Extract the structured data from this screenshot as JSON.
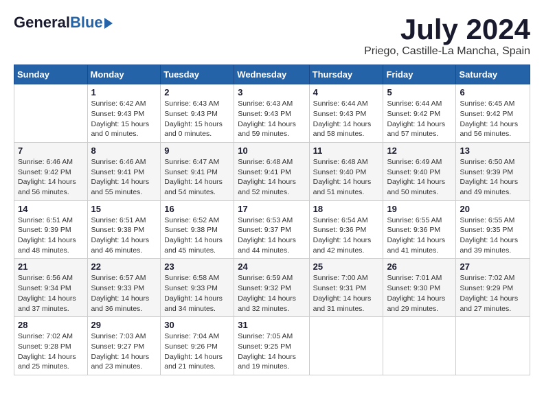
{
  "logo": {
    "general": "General",
    "blue": "Blue"
  },
  "title": {
    "month_year": "July 2024",
    "location": "Priego, Castille-La Mancha, Spain"
  },
  "days_of_week": [
    "Sunday",
    "Monday",
    "Tuesday",
    "Wednesday",
    "Thursday",
    "Friday",
    "Saturday"
  ],
  "weeks": [
    [
      {
        "day": "",
        "info": ""
      },
      {
        "day": "1",
        "info": "Sunrise: 6:42 AM\nSunset: 9:43 PM\nDaylight: 15 hours\nand 0 minutes."
      },
      {
        "day": "2",
        "info": "Sunrise: 6:43 AM\nSunset: 9:43 PM\nDaylight: 15 hours\nand 0 minutes."
      },
      {
        "day": "3",
        "info": "Sunrise: 6:43 AM\nSunset: 9:43 PM\nDaylight: 14 hours\nand 59 minutes."
      },
      {
        "day": "4",
        "info": "Sunrise: 6:44 AM\nSunset: 9:43 PM\nDaylight: 14 hours\nand 58 minutes."
      },
      {
        "day": "5",
        "info": "Sunrise: 6:44 AM\nSunset: 9:42 PM\nDaylight: 14 hours\nand 57 minutes."
      },
      {
        "day": "6",
        "info": "Sunrise: 6:45 AM\nSunset: 9:42 PM\nDaylight: 14 hours\nand 56 minutes."
      }
    ],
    [
      {
        "day": "7",
        "info": "Sunrise: 6:46 AM\nSunset: 9:42 PM\nDaylight: 14 hours\nand 56 minutes."
      },
      {
        "day": "8",
        "info": "Sunrise: 6:46 AM\nSunset: 9:41 PM\nDaylight: 14 hours\nand 55 minutes."
      },
      {
        "day": "9",
        "info": "Sunrise: 6:47 AM\nSunset: 9:41 PM\nDaylight: 14 hours\nand 54 minutes."
      },
      {
        "day": "10",
        "info": "Sunrise: 6:48 AM\nSunset: 9:41 PM\nDaylight: 14 hours\nand 52 minutes."
      },
      {
        "day": "11",
        "info": "Sunrise: 6:48 AM\nSunset: 9:40 PM\nDaylight: 14 hours\nand 51 minutes."
      },
      {
        "day": "12",
        "info": "Sunrise: 6:49 AM\nSunset: 9:40 PM\nDaylight: 14 hours\nand 50 minutes."
      },
      {
        "day": "13",
        "info": "Sunrise: 6:50 AM\nSunset: 9:39 PM\nDaylight: 14 hours\nand 49 minutes."
      }
    ],
    [
      {
        "day": "14",
        "info": "Sunrise: 6:51 AM\nSunset: 9:39 PM\nDaylight: 14 hours\nand 48 minutes."
      },
      {
        "day": "15",
        "info": "Sunrise: 6:51 AM\nSunset: 9:38 PM\nDaylight: 14 hours\nand 46 minutes."
      },
      {
        "day": "16",
        "info": "Sunrise: 6:52 AM\nSunset: 9:38 PM\nDaylight: 14 hours\nand 45 minutes."
      },
      {
        "day": "17",
        "info": "Sunrise: 6:53 AM\nSunset: 9:37 PM\nDaylight: 14 hours\nand 44 minutes."
      },
      {
        "day": "18",
        "info": "Sunrise: 6:54 AM\nSunset: 9:36 PM\nDaylight: 14 hours\nand 42 minutes."
      },
      {
        "day": "19",
        "info": "Sunrise: 6:55 AM\nSunset: 9:36 PM\nDaylight: 14 hours\nand 41 minutes."
      },
      {
        "day": "20",
        "info": "Sunrise: 6:55 AM\nSunset: 9:35 PM\nDaylight: 14 hours\nand 39 minutes."
      }
    ],
    [
      {
        "day": "21",
        "info": "Sunrise: 6:56 AM\nSunset: 9:34 PM\nDaylight: 14 hours\nand 37 minutes."
      },
      {
        "day": "22",
        "info": "Sunrise: 6:57 AM\nSunset: 9:33 PM\nDaylight: 14 hours\nand 36 minutes."
      },
      {
        "day": "23",
        "info": "Sunrise: 6:58 AM\nSunset: 9:33 PM\nDaylight: 14 hours\nand 34 minutes."
      },
      {
        "day": "24",
        "info": "Sunrise: 6:59 AM\nSunset: 9:32 PM\nDaylight: 14 hours\nand 32 minutes."
      },
      {
        "day": "25",
        "info": "Sunrise: 7:00 AM\nSunset: 9:31 PM\nDaylight: 14 hours\nand 31 minutes."
      },
      {
        "day": "26",
        "info": "Sunrise: 7:01 AM\nSunset: 9:30 PM\nDaylight: 14 hours\nand 29 minutes."
      },
      {
        "day": "27",
        "info": "Sunrise: 7:02 AM\nSunset: 9:29 PM\nDaylight: 14 hours\nand 27 minutes."
      }
    ],
    [
      {
        "day": "28",
        "info": "Sunrise: 7:02 AM\nSunset: 9:28 PM\nDaylight: 14 hours\nand 25 minutes."
      },
      {
        "day": "29",
        "info": "Sunrise: 7:03 AM\nSunset: 9:27 PM\nDaylight: 14 hours\nand 23 minutes."
      },
      {
        "day": "30",
        "info": "Sunrise: 7:04 AM\nSunset: 9:26 PM\nDaylight: 14 hours\nand 21 minutes."
      },
      {
        "day": "31",
        "info": "Sunrise: 7:05 AM\nSunset: 9:25 PM\nDaylight: 14 hours\nand 19 minutes."
      },
      {
        "day": "",
        "info": ""
      },
      {
        "day": "",
        "info": ""
      },
      {
        "day": "",
        "info": ""
      }
    ]
  ]
}
